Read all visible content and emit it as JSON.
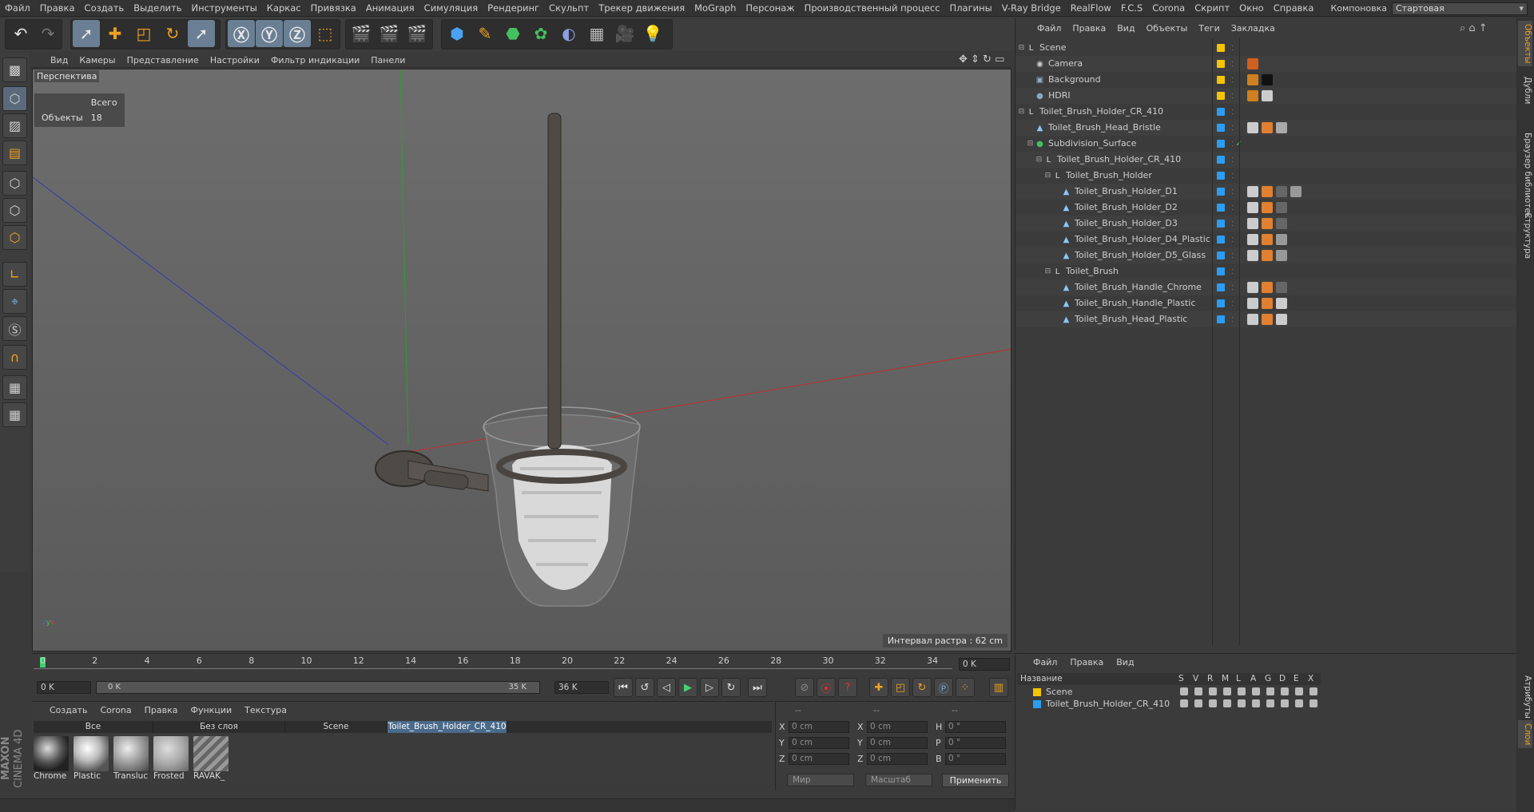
{
  "menubar": {
    "items": [
      "Файл",
      "Правка",
      "Создать",
      "Выделить",
      "Инструменты",
      "Каркас",
      "Привязка",
      "Анимация",
      "Симуляция",
      "Рендеринг",
      "Скульпт",
      "Трекер движения",
      "MoGraph",
      "Персонаж",
      "Производственный процесс",
      "Плагины",
      "V-Ray Bridge",
      "RealFlow",
      "F.C.S",
      "Corona",
      "Скрипт",
      "Окно",
      "Справка"
    ],
    "layout_label": "Компоновка",
    "layout_value": "Стартовая"
  },
  "viewport": {
    "menu": [
      "Вид",
      "Камеры",
      "Представление",
      "Настройки",
      "Фильтр индикации",
      "Панели"
    ],
    "label": "Перспектива",
    "stats": {
      "header": "Всего",
      "row_label": "Объекты",
      "row_value": "18"
    },
    "grid_interval": "Интервал растра : 62 cm"
  },
  "timeline": {
    "ticks": [
      "0",
      "2",
      "4",
      "6",
      "8",
      "10",
      "12",
      "14",
      "16",
      "18",
      "20",
      "22",
      "24",
      "26",
      "28",
      "30",
      "32",
      "34"
    ],
    "frame_field": "0 K"
  },
  "timectrl": {
    "start": "0 K",
    "range_start": "0 K",
    "range_end": "35 K",
    "end": "36 K"
  },
  "matmgr": {
    "menu": [
      "Создать",
      "Corona",
      "Правка",
      "Функции",
      "Текстура"
    ],
    "filters": [
      "Все",
      "Без слоя",
      "Scene",
      "Toilet_Brush_Holder_CR_410"
    ],
    "materials": [
      {
        "name": "Chrome"
      },
      {
        "name": "Plastic"
      },
      {
        "name": "Transluc"
      },
      {
        "name": "Frosted"
      },
      {
        "name": "RAVAK_"
      }
    ]
  },
  "coords": {
    "headers": [
      "--",
      "--",
      "--"
    ],
    "rows": [
      {
        "a": "X",
        "av": "0 cm",
        "b": "X",
        "bv": "0 cm",
        "c": "H",
        "cv": "0 °"
      },
      {
        "a": "Y",
        "av": "0 cm",
        "b": "Y",
        "bv": "0 cm",
        "c": "P",
        "cv": "0 °"
      },
      {
        "a": "Z",
        "av": "0 cm",
        "b": "Z",
        "bv": "0 cm",
        "c": "B",
        "cv": "0 °"
      }
    ],
    "mode1": "Мир",
    "mode2": "Масштаб",
    "apply": "Применить"
  },
  "objmgr": {
    "menu": [
      "Файл",
      "Правка",
      "Вид",
      "Объекты",
      "Теги",
      "Закладка"
    ],
    "objects": [
      {
        "name": "Scene",
        "indent": 0,
        "icon": "null-icon",
        "color": "#f5c400"
      },
      {
        "name": "Camera",
        "indent": 1,
        "icon": "camera-icon",
        "color": "#f5c400"
      },
      {
        "name": "Background",
        "indent": 1,
        "icon": "background-icon",
        "color": "#f5c400"
      },
      {
        "name": "HDRI",
        "indent": 1,
        "icon": "sky-icon",
        "color": "#f5c400"
      },
      {
        "name": "Toilet_Brush_Holder_CR_410",
        "indent": 0,
        "icon": "null-icon",
        "color": "#2a9df4"
      },
      {
        "name": "Toilet_Brush_Head_Bristle",
        "indent": 1,
        "icon": "polygon-icon",
        "color": "#2a9df4"
      },
      {
        "name": "Subdivision_Surface",
        "indent": 1,
        "icon": "subdivision-icon",
        "color": "#2a9df4"
      },
      {
        "name": "Toilet_Brush_Holder_CR_410",
        "indent": 2,
        "icon": "null-icon",
        "color": "#2a9df4"
      },
      {
        "name": "Toilet_Brush_Holder",
        "indent": 3,
        "icon": "null-icon",
        "color": "#2a9df4"
      },
      {
        "name": "Toilet_Brush_Holder_D1",
        "indent": 4,
        "icon": "polygon-icon",
        "color": "#2a9df4"
      },
      {
        "name": "Toilet_Brush_Holder_D2",
        "indent": 4,
        "icon": "polygon-icon",
        "color": "#2a9df4"
      },
      {
        "name": "Toilet_Brush_Holder_D3",
        "indent": 4,
        "icon": "polygon-icon",
        "color": "#2a9df4"
      },
      {
        "name": "Toilet_Brush_Holder_D4_Plastic",
        "indent": 4,
        "icon": "polygon-icon",
        "color": "#2a9df4"
      },
      {
        "name": "Toilet_Brush_Holder_D5_Glass",
        "indent": 4,
        "icon": "polygon-icon",
        "color": "#2a9df4"
      },
      {
        "name": "Toilet_Brush",
        "indent": 3,
        "icon": "null-icon",
        "color": "#2a9df4"
      },
      {
        "name": "Toilet_Brush_Handle_Chrome",
        "indent": 4,
        "icon": "polygon-icon",
        "color": "#2a9df4"
      },
      {
        "name": "Toilet_Brush_Handle_Plastic",
        "indent": 4,
        "icon": "polygon-icon",
        "color": "#2a9df4"
      },
      {
        "name": "Toilet_Brush_Head_Plastic",
        "indent": 4,
        "icon": "polygon-icon",
        "color": "#2a9df4"
      }
    ]
  },
  "layermgr": {
    "menu": [
      "Файл",
      "Правка",
      "Вид"
    ],
    "col_name": "Название",
    "cols": [
      "S",
      "V",
      "R",
      "M",
      "L",
      "A",
      "G",
      "D",
      "E",
      "X"
    ],
    "layers": [
      {
        "name": "Scene",
        "color": "#f5c400"
      },
      {
        "name": "Toilet_Brush_Holder_CR_410",
        "color": "#2a9df4"
      }
    ]
  },
  "right_tabs": [
    "Объекты",
    "Дубли",
    "Браузер библиотек",
    "Структура",
    "Атрибуты",
    "Слои"
  ],
  "logo": {
    "line1": "MAXON",
    "line2": "CINEMA 4D"
  }
}
